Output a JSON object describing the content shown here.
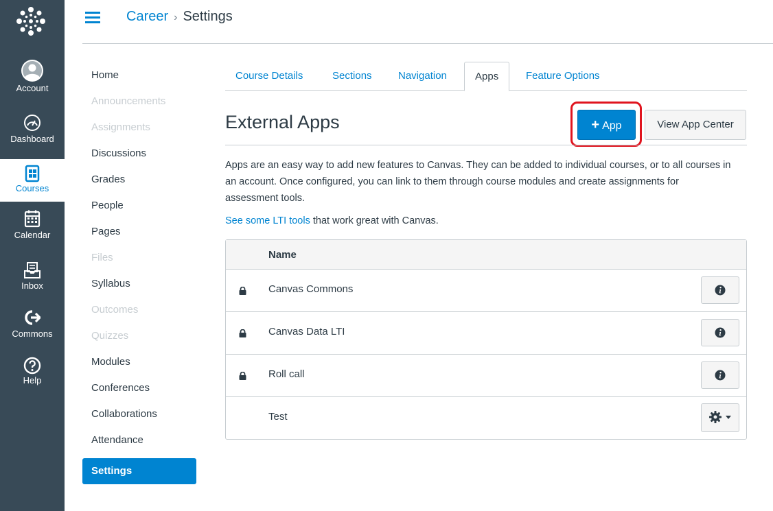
{
  "global_nav": {
    "items": [
      {
        "label": "Account",
        "icon": "account-icon"
      },
      {
        "label": "Dashboard",
        "icon": "dashboard-icon"
      },
      {
        "label": "Courses",
        "icon": "courses-icon"
      },
      {
        "label": "Calendar",
        "icon": "calendar-icon"
      },
      {
        "label": "Inbox",
        "icon": "inbox-icon"
      },
      {
        "label": "Commons",
        "icon": "commons-icon"
      },
      {
        "label": "Help",
        "icon": "help-icon"
      }
    ],
    "active": "Courses",
    "bg_color": "#384a57",
    "accent_color": "#0084d1"
  },
  "breadcrumbs": [
    "Career",
    "Settings"
  ],
  "course_nav": {
    "items": [
      {
        "label": "Home",
        "state": "enabled"
      },
      {
        "label": "Announcements",
        "state": "disabled"
      },
      {
        "label": "Assignments",
        "state": "disabled"
      },
      {
        "label": "Discussions",
        "state": "enabled"
      },
      {
        "label": "Grades",
        "state": "enabled"
      },
      {
        "label": "People",
        "state": "enabled"
      },
      {
        "label": "Pages",
        "state": "enabled"
      },
      {
        "label": "Files",
        "state": "disabled"
      },
      {
        "label": "Syllabus",
        "state": "enabled"
      },
      {
        "label": "Outcomes",
        "state": "disabled"
      },
      {
        "label": "Quizzes",
        "state": "disabled"
      },
      {
        "label": "Modules",
        "state": "enabled"
      },
      {
        "label": "Conferences",
        "state": "enabled"
      },
      {
        "label": "Collaborations",
        "state": "enabled"
      },
      {
        "label": "Attendance",
        "state": "enabled"
      },
      {
        "label": "Settings",
        "state": "active"
      }
    ]
  },
  "tabs": {
    "items": [
      "Course Details",
      "Sections",
      "Navigation",
      "Apps",
      "Feature Options"
    ],
    "active": "Apps"
  },
  "external_apps": {
    "title": "External Apps",
    "add_app_label": "App",
    "view_center_label": "View App Center",
    "description": "Apps are an easy way to add new features to Canvas. They can be added to individual courses, or to all courses in an account. Once configured, you can link to them through course modules and create assignments for assessment tools.",
    "lti_link": "See some LTI tools",
    "lti_suffix": " that work great with Canvas.",
    "table": {
      "header": "Name",
      "rows": [
        {
          "name": "Canvas Commons",
          "locked": true,
          "action": "info"
        },
        {
          "name": "Canvas Data LTI",
          "locked": true,
          "action": "info"
        },
        {
          "name": "Roll call",
          "locked": true,
          "action": "info"
        },
        {
          "name": "Test",
          "locked": false,
          "action": "settings"
        }
      ]
    }
  },
  "highlight_color": "#e0141e"
}
